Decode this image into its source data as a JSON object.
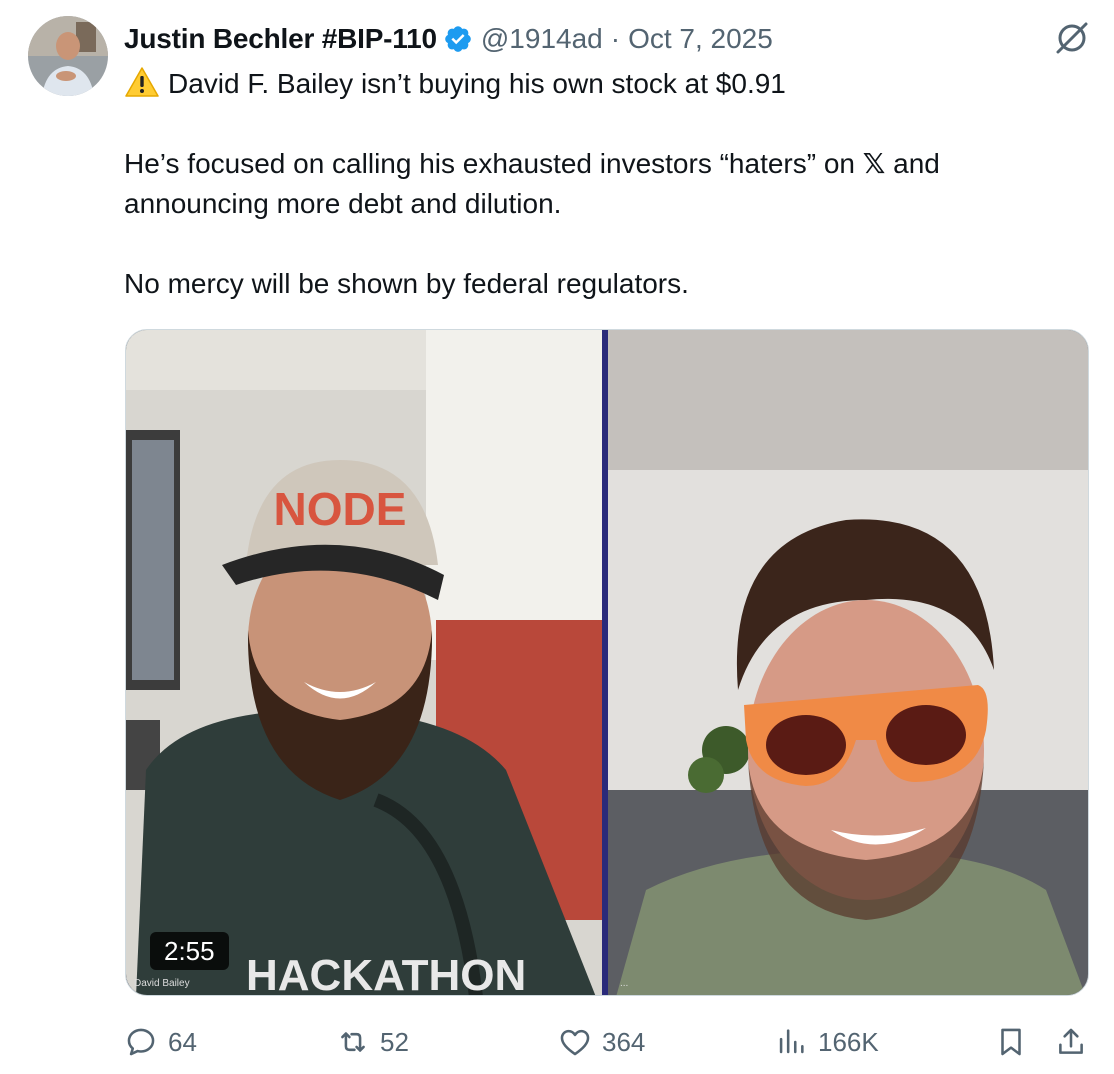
{
  "author": {
    "display_name": "Justin Bechler #BIP-110",
    "handle": "@1914ad",
    "separator": "·",
    "date": "Oct 7, 2025",
    "verified": true,
    "verified_color": "#1d9bf0"
  },
  "tweet": {
    "line1": "David F. Bailey isn’t buying his own stock at $0.91",
    "line2_a": "He’s focused on calling his exhausted investors “haters” on ",
    "line2_x": "𝕏",
    "line2_b": " and announcing more debt and dilution.",
    "line3": "No mercy will be shown by federal regulators.",
    "warning_icon": "warning-icon"
  },
  "media": {
    "duration": "2:55",
    "left_caption": "David Bailey",
    "right_caption": "...",
    "cap_text": "NODE",
    "shirt_text": "HACKATHON"
  },
  "actions": {
    "replies": "64",
    "reposts": "52",
    "likes": "364",
    "views": "166K"
  },
  "colors": {
    "text": "#0f1419",
    "muted": "#536471",
    "border": "#cfd9de"
  }
}
